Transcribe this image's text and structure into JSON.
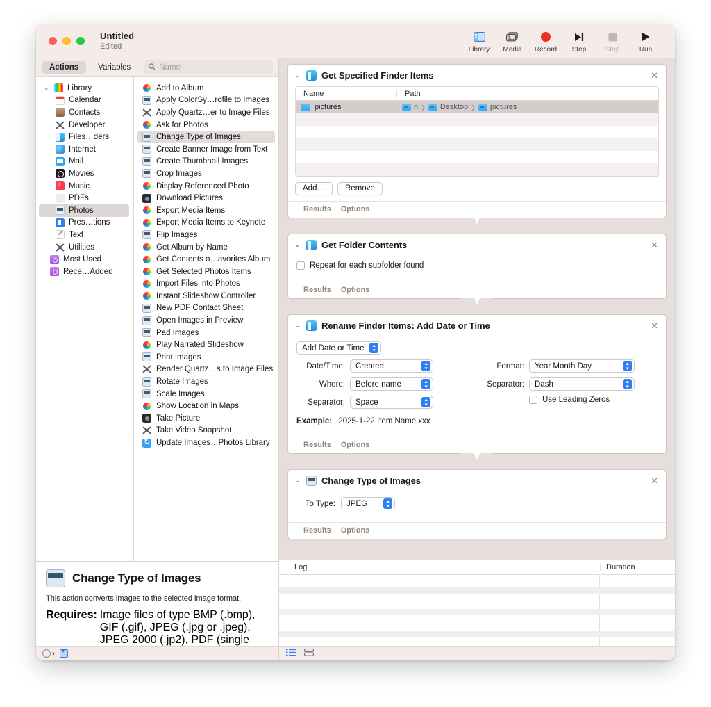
{
  "window": {
    "title": "Untitled",
    "subtitle": "Edited"
  },
  "toolbar": {
    "items": [
      {
        "label": "Library",
        "icon": "library-icon",
        "disabled": false
      },
      {
        "label": "Media",
        "icon": "media-icon",
        "disabled": false
      },
      {
        "label": "Record",
        "icon": "record-icon",
        "disabled": false
      },
      {
        "label": "Step",
        "icon": "step-icon",
        "disabled": false
      },
      {
        "label": "Stop",
        "icon": "stop-icon",
        "disabled": true
      },
      {
        "label": "Run",
        "icon": "run-icon",
        "disabled": false
      }
    ]
  },
  "tabs": {
    "actions": "Actions",
    "variables": "Variables",
    "search_placeholder": "Name",
    "search_value": "",
    "search_icon": "search-icon"
  },
  "library": {
    "root": "Library",
    "items": [
      {
        "label": "Calendar",
        "icon": "calendar-icon",
        "selected": false
      },
      {
        "label": "Contacts",
        "icon": "contacts-icon",
        "selected": false
      },
      {
        "label": "Developer",
        "icon": "developer-icon",
        "selected": false
      },
      {
        "label": "Files…ders",
        "icon": "finder-icon",
        "selected": false
      },
      {
        "label": "Internet",
        "icon": "internet-icon",
        "selected": false
      },
      {
        "label": "Mail",
        "icon": "mail-icon",
        "selected": false
      },
      {
        "label": "Movies",
        "icon": "movies-icon",
        "selected": false
      },
      {
        "label": "Music",
        "icon": "music-icon",
        "selected": false
      },
      {
        "label": "PDFs",
        "icon": "pdf-icon",
        "selected": false
      },
      {
        "label": "Photos",
        "icon": "photos-icon",
        "selected": true
      },
      {
        "label": "Pres…tions",
        "icon": "presentation-icon",
        "selected": false
      },
      {
        "label": "Text",
        "icon": "text-icon",
        "selected": false
      },
      {
        "label": "Utilities",
        "icon": "utilities-icon",
        "selected": false
      }
    ],
    "groups": [
      {
        "label": "Most Used",
        "icon": "smart-folder-icon"
      },
      {
        "label": "Rece…Added",
        "icon": "smart-folder-icon"
      }
    ]
  },
  "actions_list": [
    {
      "label": "Add to Album",
      "icon": "photos-wheel-icon",
      "selected": false
    },
    {
      "label": "Apply ColorSy…rofile to Images",
      "icon": "image-action-icon",
      "selected": false
    },
    {
      "label": "Apply Quartz…er to Image Files",
      "icon": "utilities-icon",
      "selected": false
    },
    {
      "label": "Ask for Photos",
      "icon": "photos-wheel-icon",
      "selected": false
    },
    {
      "label": "Change Type of Images",
      "icon": "image-action-icon",
      "selected": true
    },
    {
      "label": "Create Banner Image from Text",
      "icon": "image-action-icon",
      "selected": false
    },
    {
      "label": "Create Thumbnail Images",
      "icon": "image-action-icon",
      "selected": false
    },
    {
      "label": "Crop Images",
      "icon": "image-action-icon",
      "selected": false
    },
    {
      "label": "Display Referenced Photo",
      "icon": "photos-wheel-icon",
      "selected": false
    },
    {
      "label": "Download Pictures",
      "icon": "camera-icon",
      "selected": false
    },
    {
      "label": "Export Media Items",
      "icon": "photos-wheel-icon",
      "selected": false
    },
    {
      "label": "Export Media Items to Keynote",
      "icon": "photos-wheel-icon",
      "selected": false
    },
    {
      "label": "Flip Images",
      "icon": "image-action-icon",
      "selected": false
    },
    {
      "label": "Get Album by Name",
      "icon": "photos-wheel-icon",
      "selected": false
    },
    {
      "label": "Get Contents o…avorites Album",
      "icon": "photos-wheel-icon",
      "selected": false
    },
    {
      "label": "Get Selected Photos Items",
      "icon": "photos-wheel-icon",
      "selected": false
    },
    {
      "label": "Import Files into Photos",
      "icon": "photos-wheel-icon",
      "selected": false
    },
    {
      "label": "Instant Slideshow Controller",
      "icon": "photos-wheel-icon",
      "selected": false
    },
    {
      "label": "New PDF Contact Sheet",
      "icon": "image-action-icon",
      "selected": false
    },
    {
      "label": "Open Images in Preview",
      "icon": "image-action-icon",
      "selected": false
    },
    {
      "label": "Pad Images",
      "icon": "image-action-icon",
      "selected": false
    },
    {
      "label": "Play Narrated Slideshow",
      "icon": "photos-wheel-icon",
      "selected": false
    },
    {
      "label": "Print Images",
      "icon": "image-action-icon",
      "selected": false
    },
    {
      "label": "Render Quartz…s to Image Files",
      "icon": "utilities-icon",
      "selected": false
    },
    {
      "label": "Rotate Images",
      "icon": "image-action-icon",
      "selected": false
    },
    {
      "label": "Scale Images",
      "icon": "image-action-icon",
      "selected": false
    },
    {
      "label": "Show Location in Maps",
      "icon": "photos-wheel-icon",
      "selected": false
    },
    {
      "label": "Take Picture",
      "icon": "camera-icon",
      "selected": false
    },
    {
      "label": "Take Video Snapshot",
      "icon": "utilities-icon",
      "selected": false
    },
    {
      "label": "Update Images…Photos Library",
      "icon": "update-icon",
      "selected": false
    }
  ],
  "description": {
    "title": "Change Type of Images",
    "icon": "image-action-icon",
    "summary": "This action converts images to the selected image format.",
    "requires_label": "Requires:",
    "requires_text": "Image files of type BMP (.bmp), GIF (.gif), JPEG (.jpg or .jpeg), JPEG 2000 (.jp2), PDF (single page .pdf), PNG (.png), or TIFF (.tif or .tiff)."
  },
  "workflow": {
    "footer_results": "Results",
    "footer_options": "Options",
    "close_glyph": "✕",
    "disclosure_glyph": "⌄",
    "actions": [
      {
        "title": "Get Specified Finder Items",
        "icon": "finder-action-icon",
        "table": {
          "columns": [
            "Name",
            "Path"
          ],
          "rows": [
            {
              "name": "pictures",
              "path_crumbs": [
                "n",
                "Desktop",
                "pictures"
              ],
              "selected": true
            }
          ]
        },
        "buttons": [
          "Add…",
          "Remove"
        ]
      },
      {
        "title": "Get Folder Contents",
        "icon": "finder-action-icon",
        "checkbox": {
          "label": "Repeat for each subfolder found",
          "checked": false
        }
      },
      {
        "title": "Rename Finder Items: Add Date or Time",
        "icon": "finder-action-icon",
        "mode_popup": "Add Date or Time",
        "fields_left": [
          {
            "label": "Date/Time:",
            "value": "Created"
          },
          {
            "label": "Where:",
            "value": "Before name"
          },
          {
            "label": "Separator:",
            "value": "Space"
          }
        ],
        "fields_right": [
          {
            "label": "Format:",
            "value": "Year Month Day"
          },
          {
            "label": "Separator:",
            "value": "Dash"
          }
        ],
        "leading_zeros": {
          "label": "Use Leading Zeros",
          "checked": false
        },
        "example_label": "Example:",
        "example_value": "2025-1-22 Item Name.xxx"
      },
      {
        "title": "Change Type of Images",
        "icon": "image-action-icon",
        "to_type_label": "To Type:",
        "to_type_value": "JPEG"
      }
    ]
  },
  "log": {
    "columns": {
      "log": "Log",
      "duration": "Duration"
    },
    "rows": []
  },
  "statusbar": {
    "left_icon": "more-options-icon",
    "chevron_icon": "chevron-down-icon",
    "right_icon": "show-variables-icon"
  },
  "log_footer": {
    "list_icon": "log-list-icon",
    "split_icon": "log-split-icon"
  },
  "colors": {
    "accent": "#2f7ff0",
    "record": "#e8322a",
    "window_chrome": "#f5ecea",
    "workflow_bg": "#e5dedb",
    "selection": "#dcd6d4"
  }
}
